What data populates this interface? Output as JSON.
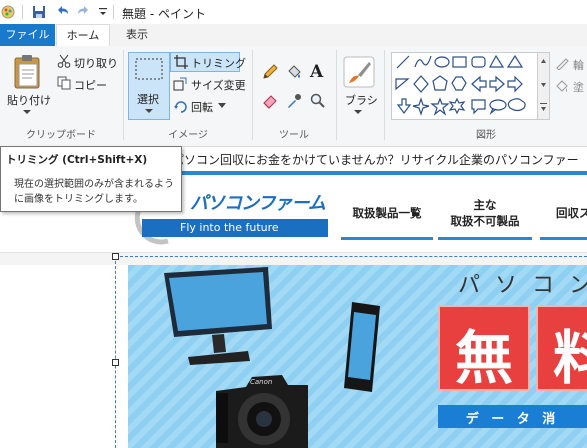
{
  "window": {
    "title": "無題 - ペイント"
  },
  "tabs": {
    "file": "ファイル",
    "home": "ホーム",
    "view": "表示"
  },
  "clipboard": {
    "paste": "貼り付け",
    "cut": "切り取り",
    "copy": "コピー",
    "group_label": "クリップボード"
  },
  "image": {
    "select": "選択",
    "crop": "トリミング",
    "resize": "サイズ変更",
    "rotate": "回転",
    "group_label": "イメージ"
  },
  "tools": {
    "group_label": "ツール"
  },
  "brushes": {
    "label": "ブラシ"
  },
  "shapes": {
    "group_label": "図形",
    "outline_partial": "輪",
    "fill_partial": "塗"
  },
  "tooltip": {
    "title": "トリミング (Ctrl+Shift+X)",
    "body": "現在の選択範囲のみが含まれるように画像をトリミングします。"
  },
  "webpage": {
    "banner_text": "パソコン回収にお金をかけていませんか？リサイクル企業のパソコンファー",
    "logo_text": "パソコンファーム",
    "logo_tagline": "Fly into the future",
    "nav": [
      "取扱製品一覧",
      "主な",
      "取扱不可製品",
      "回収ス"
    ],
    "hero_heading_partial": "パ ソ コ ン",
    "hero_char_1": "無",
    "hero_char_2": "料",
    "hero_footer_partial": "デ ー タ 消",
    "camera_brand": "Canon"
  },
  "colors": {
    "accent": "#1979ca",
    "hero_bg": "#8fd0f2",
    "free_red": "#e8403f",
    "nav_blue": "#2a88d2"
  }
}
